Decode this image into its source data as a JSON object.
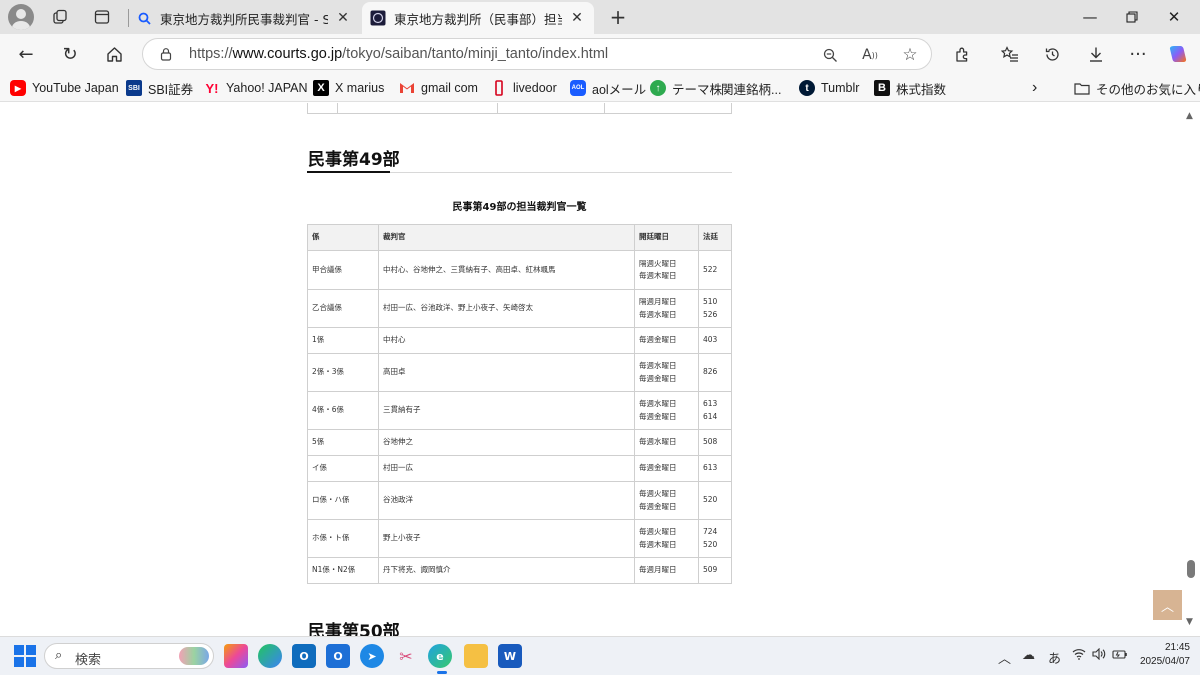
{
  "browser": {
    "tabs": [
      {
        "title": "東京地方裁判所民事裁判官 - Search",
        "icon": "search-icon"
      },
      {
        "title": "東京地方裁判所（民事部）担当裁判官",
        "icon": "court-seal-icon",
        "active": true
      }
    ],
    "url": {
      "scheme": "https://",
      "host": "www.courts.go.jp",
      "path": "/tokyo/saiban/tanto/minji_tanto/index.html"
    },
    "favorites": [
      {
        "label": "YouTube Japan",
        "icon": "youtube-icon",
        "color": "#ff0000"
      },
      {
        "label": "SBI証券",
        "icon": "sbi-icon",
        "color": "#0b3a8c"
      },
      {
        "label": "Yahoo! JAPAN",
        "icon": "yahoo-icon",
        "color": "#ff0033"
      },
      {
        "label": "X marius",
        "icon": "x-icon",
        "color": "#000000"
      },
      {
        "label": "gmail com",
        "icon": "gmail-icon",
        "color": "#ea4335"
      },
      {
        "label": "livedoor",
        "icon": "livedoor-icon",
        "color": "#d6001c"
      },
      {
        "label": "aolメール",
        "icon": "aol-icon",
        "color": "#1a5cff"
      },
      {
        "label": "テーマ株",
        "icon": "theme-stock-icon",
        "color": "#2eaa4f"
      },
      {
        "label": "関連銘柄...",
        "icon": "",
        "color": ""
      },
      {
        "label": "Tumblr",
        "icon": "tumblr-icon",
        "color": "#001935"
      },
      {
        "label": "株式指数",
        "icon": "b-icon",
        "color": "#111111"
      }
    ],
    "other_favorites": "その他のお気に入り"
  },
  "page": {
    "section_title": "民事第49部",
    "table_caption": "民事第49部の担当裁判官一覧",
    "columns": [
      "係",
      "裁判官",
      "開廷曜日",
      "法廷"
    ],
    "rows": [
      {
        "kakari": "甲合議係",
        "judges": "中村心、谷地伸之、三貫納有子、高田卓、紅林颯馬",
        "days": [
          "隔週火曜日",
          "毎週木曜日"
        ],
        "rooms": [
          "522"
        ]
      },
      {
        "kakari": "乙合議係",
        "judges": "村田一広、谷池政洋、野上小夜子、矢崎啓太",
        "days": [
          "隔週月曜日",
          "毎週水曜日"
        ],
        "rooms": [
          "510",
          "526"
        ]
      },
      {
        "kakari": "1係",
        "judges": "中村心",
        "days": [
          "毎週金曜日"
        ],
        "rooms": [
          "403"
        ]
      },
      {
        "kakari": "2係・3係",
        "judges": "高田卓",
        "days": [
          "毎週水曜日",
          "毎週金曜日"
        ],
        "rooms": [
          "826"
        ]
      },
      {
        "kakari": "4係・6係",
        "judges": "三貫納有子",
        "days": [
          "毎週水曜日",
          "毎週金曜日"
        ],
        "rooms": [
          "613",
          "614"
        ]
      },
      {
        "kakari": "5係",
        "judges": "谷地伸之",
        "days": [
          "毎週水曜日"
        ],
        "rooms": [
          "508"
        ]
      },
      {
        "kakari": "イ係",
        "judges": "村田一広",
        "days": [
          "毎週金曜日"
        ],
        "rooms": [
          "613"
        ]
      },
      {
        "kakari": "ロ係・ハ係",
        "judges": "谷池政洋",
        "days": [
          "毎週火曜日",
          "毎週金曜日"
        ],
        "rooms": [
          "520"
        ]
      },
      {
        "kakari": "ホ係・ト係",
        "judges": "野上小夜子",
        "days": [
          "毎週火曜日",
          "毎週木曜日"
        ],
        "rooms": [
          "724",
          "520"
        ]
      },
      {
        "kakari": "N1係・N2係",
        "judges": "丹下将克、諏岡慎介",
        "days": [
          "毎週月曜日"
        ],
        "rooms": [
          "509"
        ]
      }
    ],
    "next_section_title": "民事第50部"
  },
  "taskbar": {
    "search_placeholder": "検索",
    "ime": "あ",
    "time": "21:45",
    "date": "2025/04/07"
  }
}
